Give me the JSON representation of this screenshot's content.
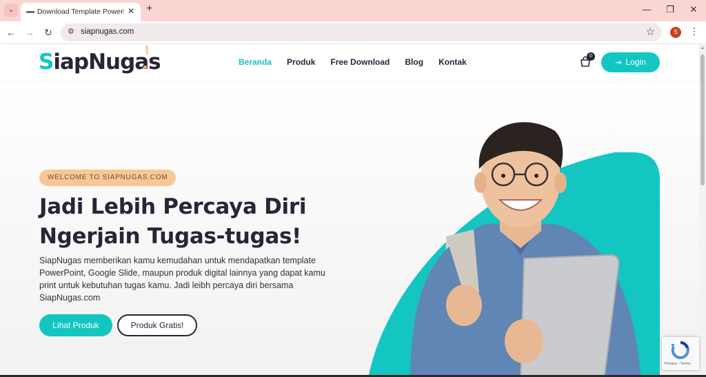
{
  "browser": {
    "tab_title": "Download Template PowerPoint",
    "url": "siapnugas.com",
    "profile_initial": "S"
  },
  "header": {
    "logo_main": "SiapNugas",
    "logo_suffix": ".com",
    "nav": [
      {
        "label": "Beranda",
        "active": true
      },
      {
        "label": "Produk",
        "active": false
      },
      {
        "label": "Free Download",
        "active": false
      },
      {
        "label": "Blog",
        "active": false
      },
      {
        "label": "Kontak",
        "active": false
      }
    ],
    "cart_count": "0",
    "login_label": "Login"
  },
  "hero": {
    "badge": "WELCOME TO SIAPNUGAS.COM",
    "headline_line1": "Jadi Lebih Percaya Diri",
    "headline_line2": "Ngerjain Tugas-tugas!",
    "description": "SiapNugas memberikan kamu kemudahan untuk mendapatkan template PowerPoint, Google Slide, maupun produk digital lainnya yang dapat kamu print untuk kebutuhan tugas kamu. Jadi leibh percaya diri bersama SiapNugas.com",
    "primary_button": "Lihat Produk",
    "secondary_button": "Produk Gratis!"
  },
  "recaptcha": {
    "footer": "Privacy - Terms"
  },
  "colors": {
    "accent": "#13c6c2",
    "dark": "#2a2438",
    "badge_bg": "#f7c896",
    "tabbar": "#fbd5d2"
  }
}
